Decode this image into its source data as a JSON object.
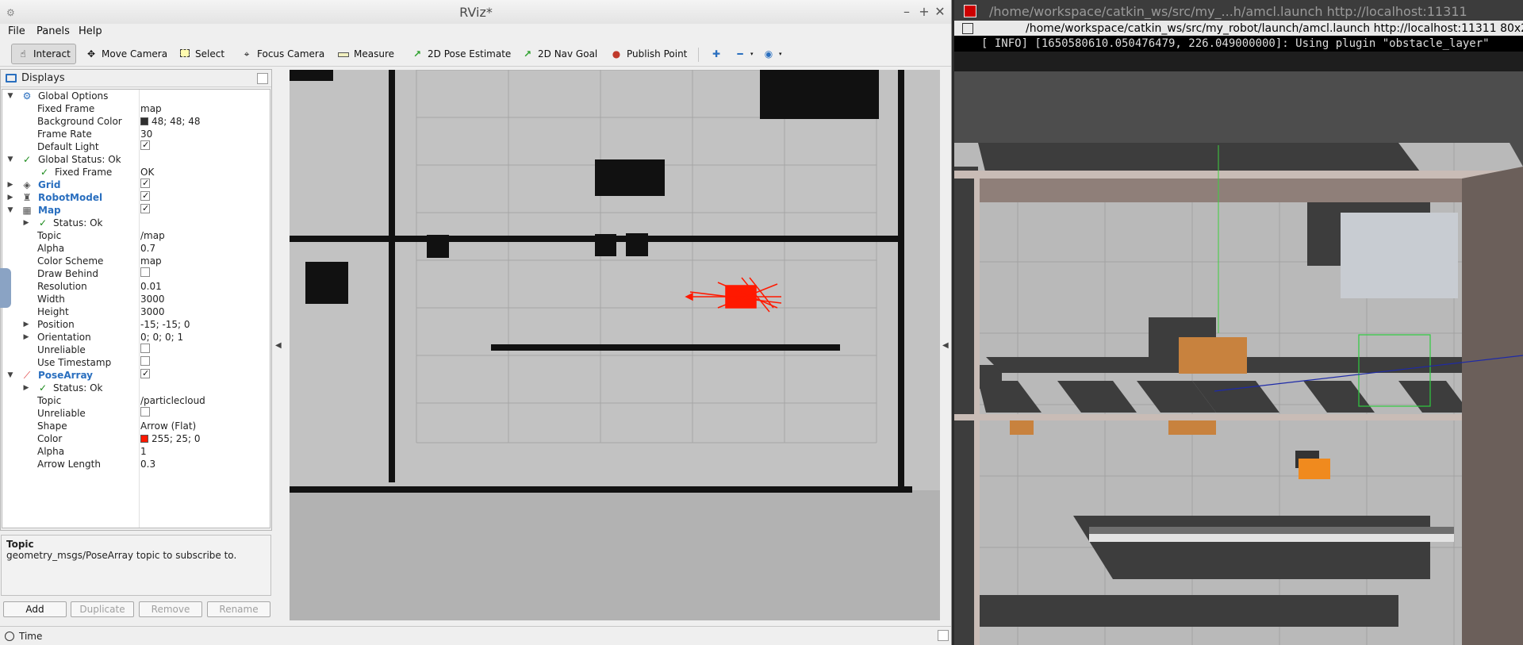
{
  "window": {
    "title": "RViz*"
  },
  "menu": [
    "File",
    "Panels",
    "Help"
  ],
  "toolbar": {
    "interact": "Interact",
    "move_camera": "Move Camera",
    "select": "Select",
    "focus_camera": "Focus Camera",
    "measure": "Measure",
    "pose_estimate": "2D Pose Estimate",
    "nav_goal": "2D Nav Goal",
    "publish_point": "Publish Point"
  },
  "displays": {
    "title": "Displays",
    "rows": [
      {
        "label": "Global Options"
      },
      {
        "label": "Fixed Frame",
        "value": "map"
      },
      {
        "label": "Background Color",
        "value": "48; 48; 48"
      },
      {
        "label": "Frame Rate",
        "value": "30"
      },
      {
        "label": "Default Light"
      },
      {
        "label": "Global Status: Ok"
      },
      {
        "label": "Fixed Frame",
        "value": "OK"
      },
      {
        "label": "Grid"
      },
      {
        "label": "RobotModel"
      },
      {
        "label": "Map"
      },
      {
        "label": "Status: Ok"
      },
      {
        "label": "Topic",
        "value": "/map"
      },
      {
        "label": "Alpha",
        "value": "0.7"
      },
      {
        "label": "Color Scheme",
        "value": "map"
      },
      {
        "label": "Draw Behind"
      },
      {
        "label": "Resolution",
        "value": "0.01"
      },
      {
        "label": "Width",
        "value": "3000"
      },
      {
        "label": "Height",
        "value": "3000"
      },
      {
        "label": "Position",
        "value": "-15; -15; 0"
      },
      {
        "label": "Orientation",
        "value": "0; 0; 0; 1"
      },
      {
        "label": "Unreliable"
      },
      {
        "label": "Use Timestamp"
      },
      {
        "label": "PoseArray"
      },
      {
        "label": "Status: Ok"
      },
      {
        "label": "Topic",
        "value": "/particlecloud"
      },
      {
        "label": "Unreliable"
      },
      {
        "label": "Shape",
        "value": "Arrow (Flat)"
      },
      {
        "label": "Color",
        "value": "255; 25; 0"
      },
      {
        "label": "Alpha",
        "value": "1"
      },
      {
        "label": "Arrow Length",
        "value": "0.3"
      }
    ],
    "colors": {
      "background": "#303030",
      "pose": "#ff1900"
    }
  },
  "description": {
    "title": "Topic",
    "text": "geometry_msgs/PoseArray topic to subscribe to."
  },
  "buttons": {
    "add": "Add",
    "duplicate": "Duplicate",
    "remove": "Remove",
    "rename": "Rename"
  },
  "time_panel": {
    "label": "Time"
  },
  "terminal": {
    "title": "/home/workspace/catkin_ws/src/my_...h/amcl.launch http://localhost:11311",
    "tab": "/home/workspace/catkin_ws/src/my_robot/launch/amcl.launch http://localhost:11311 80x2",
    "line": "[ INFO] [1650580610.050476479, 226.049000000]: Using plugin \"obstacle_layer\""
  }
}
